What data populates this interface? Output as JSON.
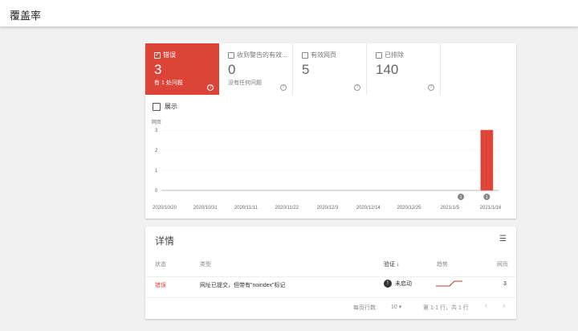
{
  "header": {
    "title": "覆盖率"
  },
  "tiles": [
    {
      "label": "错误",
      "value": "3",
      "sub": "有 1 处问题",
      "checked": true
    },
    {
      "label": "收到警告的有效...",
      "value": "0",
      "sub": "没有任何问题",
      "checked": false
    },
    {
      "label": "有效网页",
      "value": "5",
      "sub": "",
      "checked": false
    },
    {
      "label": "已排除",
      "value": "140",
      "sub": "",
      "checked": false
    }
  ],
  "help_glyph": "?",
  "show_label": "展示",
  "chart_data": {
    "type": "bar",
    "ylabel": "网页",
    "ylim": [
      0,
      3
    ],
    "yticks": [
      "0",
      "1",
      "2",
      "3"
    ],
    "xticks": [
      "2020/10/20",
      "2020/10/31",
      "2020/11/11",
      "2020/11/22",
      "2020/12/3",
      "2020/12/14",
      "2020/12/25",
      "2021/1/5",
      "2021/1/16"
    ],
    "x_range_days": 88,
    "series": [
      {
        "name": "错误",
        "color": "#db4437",
        "day_index": [
          86,
          87,
          88
        ],
        "values": [
          3,
          3,
          3
        ]
      }
    ],
    "annotations": [
      {
        "day_index": 80,
        "label": "1"
      },
      {
        "day_index": 87,
        "label": "1"
      }
    ]
  },
  "details": {
    "title": "详情",
    "columns": {
      "status": "状态",
      "type": "类型",
      "validation": "验证",
      "trend": "趋势",
      "pages": "网页"
    },
    "rows": [
      {
        "status": "错误",
        "type": "网址已提交，但带有\"noindex\"标记",
        "validation": "未启动",
        "pages": "3"
      }
    ],
    "footer": {
      "rows_per_page_label": "每页行数:",
      "rows_per_page": "10",
      "range": "第 1-1 行，共 1 行"
    }
  }
}
